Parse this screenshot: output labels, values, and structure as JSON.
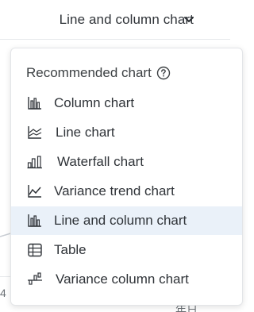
{
  "trigger": {
    "label": "Line and column chart",
    "chevron_icon": "chevron-down-icon"
  },
  "background": {
    "tick_left": "4",
    "tick_bottom": "年日"
  },
  "menu": {
    "header": "Recommended chart",
    "help_icon": "question-circle-icon",
    "selected_color": "#eaf1f9",
    "items": [
      {
        "label": "Column chart",
        "icon": "column-chart-icon"
      },
      {
        "label": "Line chart",
        "icon": "line-chart-icon"
      },
      {
        "label": "Waterfall chart",
        "icon": "waterfall-chart-icon"
      },
      {
        "label": "Variance trend chart",
        "icon": "variance-trend-chart-icon"
      },
      {
        "label": "Line and column chart",
        "icon": "line-and-column-chart-icon",
        "selected": true
      },
      {
        "label": "Table",
        "icon": "table-icon"
      },
      {
        "label": "Variance column chart",
        "icon": "variance-column-chart-icon"
      }
    ]
  }
}
